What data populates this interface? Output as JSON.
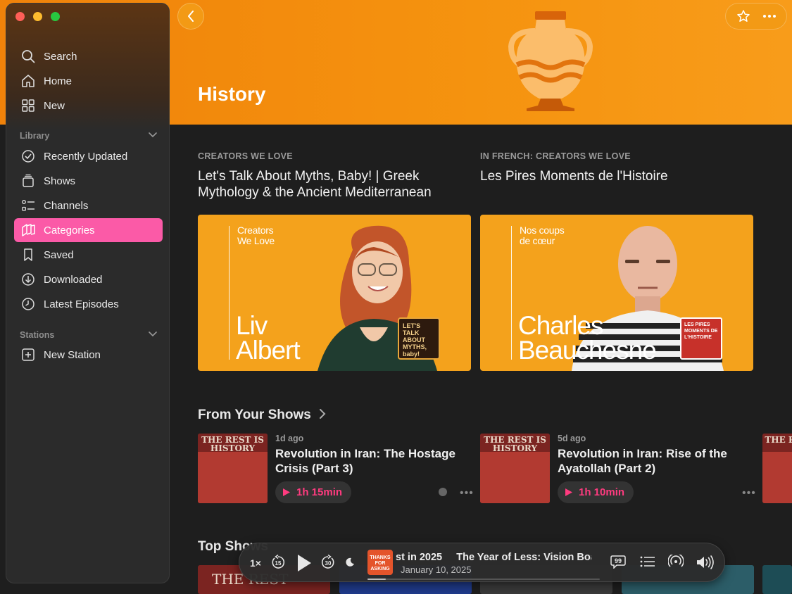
{
  "sidebar": {
    "top_items": [
      {
        "label": "Search",
        "icon": "search-icon"
      },
      {
        "label": "Home",
        "icon": "house-icon"
      },
      {
        "label": "New",
        "icon": "grid-icon"
      }
    ],
    "library_label": "Library",
    "library_items": [
      {
        "label": "Recently Updated",
        "icon": "checkmark-circle-icon"
      },
      {
        "label": "Shows",
        "icon": "stack-icon"
      },
      {
        "label": "Channels",
        "icon": "list-icon"
      },
      {
        "label": "Categories",
        "icon": "categories-icon",
        "active": true
      },
      {
        "label": "Saved",
        "icon": "bookmark-icon"
      },
      {
        "label": "Downloaded",
        "icon": "download-icon"
      },
      {
        "label": "Latest Episodes",
        "icon": "clock-icon"
      }
    ],
    "stations_label": "Stations",
    "stations_items": [
      {
        "label": "New Station",
        "icon": "plus-square-icon"
      }
    ]
  },
  "hero": {
    "title": "History",
    "color": "#f5930f"
  },
  "featured": [
    {
      "eyebrow": "CREATORS WE LOVE",
      "title": "Let's Talk About Myths, Baby! | Greek Mythology & the Ancient Mediterranean",
      "card_small": "Creators\nWe Love",
      "card_name": "Liv\nAlbert",
      "badge": "LET'S TALK ABOUT MYTHS, baby!"
    },
    {
      "eyebrow": "IN FRENCH: CREATORS WE LOVE",
      "title": "Les Pires Moments de l'Histoire",
      "card_small": "Nos coups\nde cœur",
      "card_name": "Charles\nBeauchesne",
      "badge": "LES PIRES MOMENTS DE L'HISTOIRE"
    }
  ],
  "from_your_shows": {
    "title": "From Your Shows",
    "episodes": [
      {
        "art_text": "THE REST IS HISTORY",
        "age": "1d ago",
        "title": "Revolution in Iran: The Hostage Crisis (Part 3)",
        "duration": "1h 15min"
      },
      {
        "art_text": "THE REST IS HISTORY",
        "age": "5d ago",
        "title": "Revolution in Iran: Rise of the Ayatollah (Part 2)",
        "duration": "1h 10min"
      },
      {
        "art_text": "THE RE IS HI"
      }
    ]
  },
  "top_shows": {
    "title": "Top Shows",
    "thumb_text": "THE REST"
  },
  "player": {
    "speed": "1×",
    "skip_back": "15",
    "skip_fwd": "30",
    "now_playing_title": "st in 2025     The Year of Less: Vision Boa",
    "now_playing_date": "January 10, 2025",
    "art_text": "THANKS FOR ASKING",
    "progress": 0.08
  },
  "colors": {
    "accent": "#fb5aa7",
    "duration_pink": "#ff3b7f"
  }
}
